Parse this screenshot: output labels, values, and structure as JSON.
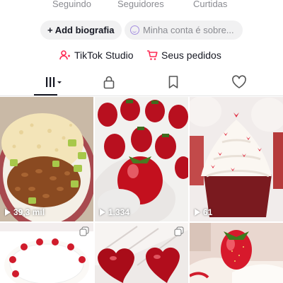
{
  "stats": {
    "following_label": "Seguindo",
    "followers_label": "Seguidores",
    "likes_label": "Curtidas"
  },
  "bio": {
    "add_bio_label": "+ Add biografia",
    "about_placeholder": "Minha conta é sobre..."
  },
  "links": {
    "studio_label": "TikTok Studio",
    "orders_label": "Seus pedidos"
  },
  "tabs": [
    {
      "name": "videos",
      "icon": "grid-icon",
      "selected": true
    },
    {
      "name": "private",
      "icon": "lock-icon"
    },
    {
      "name": "favorites",
      "icon": "bookmark-icon"
    },
    {
      "name": "liked",
      "icon": "heart-icon"
    }
  ],
  "videos": [
    {
      "subject": "plate of rice, beans, avocado",
      "views": "39,3 mil"
    },
    {
      "subject": "chocolate-covered strawberries",
      "views": "1.334"
    },
    {
      "subject": "red velvet cupcake",
      "views": "61"
    },
    {
      "subject": "white cake with strawberries",
      "views": ""
    },
    {
      "subject": "red glazed hearts",
      "views": ""
    },
    {
      "subject": "strawberry cupcake",
      "views": ""
    }
  ],
  "colors": {
    "accent": "#fe2c55",
    "studio_icon": "#fe2c55",
    "orders_icon": "#fe2c55",
    "text_muted": "#8a8b91"
  }
}
